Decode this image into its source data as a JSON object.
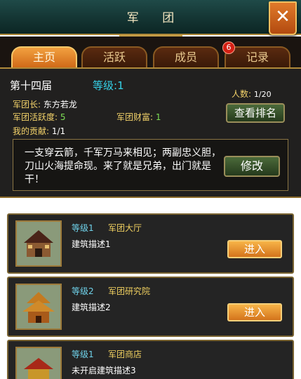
{
  "header": {
    "title": "军 团",
    "close_label": "✕"
  },
  "tabs": [
    {
      "label": "主页",
      "active": true
    },
    {
      "label": "活跃",
      "active": false
    },
    {
      "label": "成员",
      "active": false
    },
    {
      "label": "记录",
      "active": false
    }
  ],
  "member_badge": "6",
  "info": {
    "session": "第十四届",
    "level_label": "等级:",
    "level_value": "1",
    "leader_label": "军团长:",
    "leader_value": "东方若龙",
    "member_label": "人数:",
    "member_value": "1/20",
    "activity_label": "军团活跃度:",
    "activity_value": "5",
    "wealth_label": "军团财富:",
    "wealth_value": "1",
    "contribution_label": "我的贡献:",
    "contribution_value": "1/1",
    "rank_button": "查看排名",
    "motto": "一支穿云箭，千军万马来相见；两副忠义胆，刀山火海提命现。来了就是兄弟，出门就是干！",
    "edit_button": "修改"
  },
  "buildings": [
    {
      "level_label": "等级",
      "level": "1",
      "name": "军团大厅",
      "desc": "建筑描述1",
      "button": "进入"
    },
    {
      "level_label": "等级",
      "level": "2",
      "name": "军团研究院",
      "desc": "建筑描述2",
      "button": "进入"
    },
    {
      "level_label": "等级",
      "level": "1",
      "name": "军团商店",
      "desc": "未开启建筑描述3",
      "button": ""
    }
  ]
}
